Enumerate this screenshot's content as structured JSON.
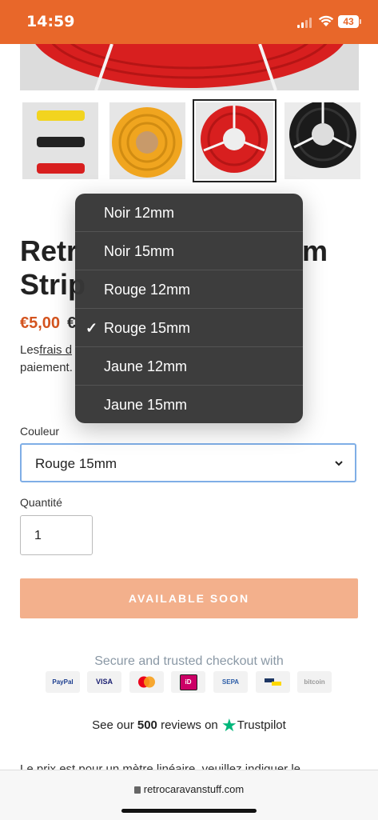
{
  "status_bar": {
    "time": "14:59",
    "battery": "43"
  },
  "product": {
    "title_line1": "Retr",
    "title_line1_end": "m",
    "title_line2": "Strip",
    "price": "€5,00",
    "price_old": "€",
    "shipping_text_a": "Les",
    "shipping_text_link": "frais d",
    "shipping_text_b": "paiement."
  },
  "variant": {
    "label": "Couleur",
    "selected": "Rouge 15mm",
    "options": [
      {
        "label": "Noir 12mm",
        "checked": false
      },
      {
        "label": "Noir 15mm",
        "checked": false
      },
      {
        "label": "Rouge 12mm",
        "checked": false
      },
      {
        "label": "Rouge 15mm",
        "checked": true
      },
      {
        "label": "Jaune 12mm",
        "checked": false
      },
      {
        "label": "Jaune 15mm",
        "checked": false
      }
    ],
    "checkmark": "✓"
  },
  "quantity": {
    "label": "Quantité",
    "value": "1"
  },
  "cta": {
    "label": "AVAILABLE SOON"
  },
  "checkout": {
    "heading": "Secure and trusted checkout with",
    "methods": [
      "PayPal",
      "VISA",
      "Mastercard",
      "iD",
      "SEPA",
      "Bancontact",
      "bitcoin"
    ]
  },
  "reviews": {
    "prefix": "See our",
    "count": "500",
    "middle": "reviews on",
    "brand": "Trustpilot"
  },
  "description": "Le prix est pour un mètre linéaire, veuillez indiquer le",
  "browser": {
    "url": "retrocaravanstuff.com"
  },
  "colors": {
    "brand_orange": "#e8672a",
    "cta": "#f3b08c",
    "price": "#d4541f",
    "trustpilot": "#00b67a"
  }
}
